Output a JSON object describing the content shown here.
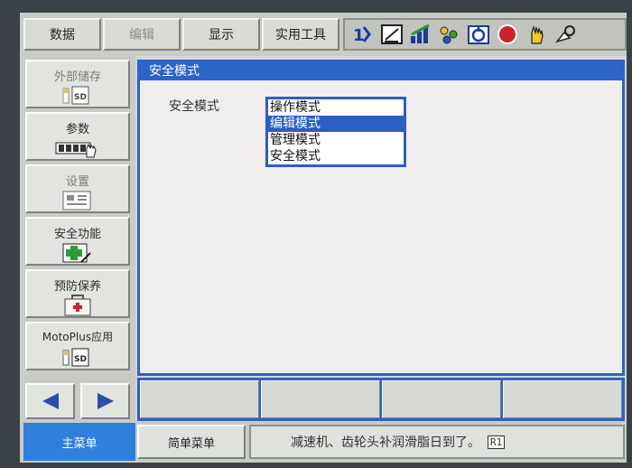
{
  "top_menu": [
    "数据",
    "编辑",
    "显示",
    "实用工具"
  ],
  "status_icons": [
    "numeric-mode-icon",
    "edit-icon",
    "signal-icon",
    "robot-group-icon",
    "cycle-icon",
    "stop-lamp-icon",
    "hand-icon",
    "lock-icon"
  ],
  "sidebar": {
    "items": [
      {
        "label": "外部储存",
        "icon": "sd-card-icon",
        "disabled": true
      },
      {
        "label": "参数",
        "icon": "parameter-hand-icon",
        "disabled": false
      },
      {
        "label": "设置",
        "icon": "setup-icon",
        "disabled": true
      },
      {
        "label": "安全功能",
        "icon": "safety-function-icon",
        "disabled": false
      },
      {
        "label": "预防保养",
        "icon": "first-aid-kit-icon",
        "disabled": false
      },
      {
        "label": "MotoPlus应用",
        "icon": "sd-card-icon",
        "disabled": false
      }
    ]
  },
  "main": {
    "title": "安全模式",
    "field_label": "安全模式",
    "dropdown_options": [
      "操作模式",
      "编辑模式",
      "管理模式",
      "安全模式"
    ],
    "selected_index": 1
  },
  "bottom": {
    "main_menu": "主菜单",
    "simple_menu": "简单菜单",
    "message": "减速机、齿轮头补润滑脂日到了。",
    "message_tag": "R1"
  },
  "colors": {
    "accent": "#2e64c8",
    "main_menu_bg": "#2f7fde",
    "stop_red": "#d0202c"
  }
}
